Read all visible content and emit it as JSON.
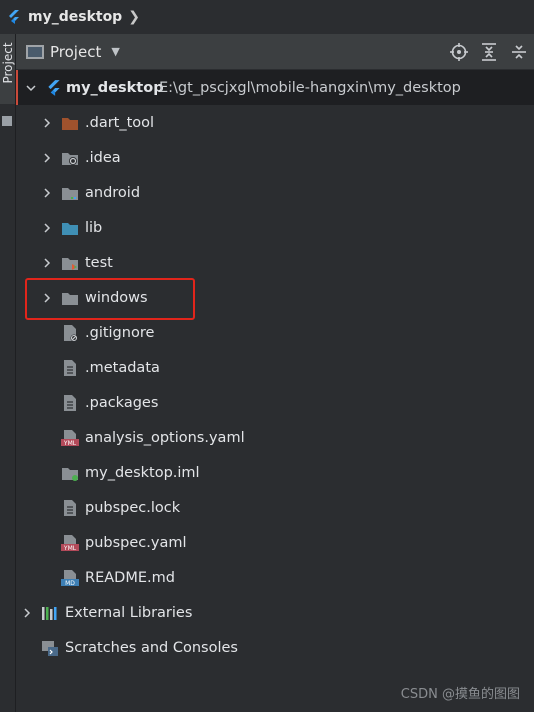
{
  "breadcrumb": {
    "project": "my_desktop"
  },
  "toolwindow": {
    "side_tab_label": "Project",
    "title": "Project",
    "toolbar_icons": [
      "crosshair-icon",
      "collapse-all-icon",
      "expand-icon"
    ]
  },
  "tree": {
    "root": {
      "name": "my_desktop",
      "path": "E:\\gt_pscjxgl\\mobile-hangxin\\my_desktop"
    },
    "folders": [
      {
        "label": ".dart_tool",
        "icon": "folder-excluded-icon",
        "color": "#a0522d"
      },
      {
        "label": ".idea",
        "icon": "folder-idea-icon",
        "color": "#8a8f94"
      },
      {
        "label": "android",
        "icon": "folder-module-icon",
        "color": "#8a8f94"
      },
      {
        "label": "lib",
        "icon": "folder-source-icon",
        "color": "#3f8fb5"
      },
      {
        "label": "test",
        "icon": "folder-test-icon",
        "color": "#8a8f94"
      },
      {
        "label": "windows",
        "icon": "folder-icon",
        "color": "#8a8f94"
      }
    ],
    "files": [
      {
        "label": ".gitignore",
        "icon": "gitignore-file-icon"
      },
      {
        "label": ".metadata",
        "icon": "text-file-icon"
      },
      {
        "label": ".packages",
        "icon": "text-file-icon"
      },
      {
        "label": "analysis_options.yaml",
        "icon": "yaml-file-icon"
      },
      {
        "label": "my_desktop.iml",
        "icon": "iml-file-icon"
      },
      {
        "label": "pubspec.lock",
        "icon": "text-file-icon"
      },
      {
        "label": "pubspec.yaml",
        "icon": "yaml-file-icon"
      },
      {
        "label": "README.md",
        "icon": "markdown-file-icon"
      }
    ],
    "external_libraries": "External Libraries",
    "scratches": "Scratches and Consoles"
  },
  "watermark": "CSDN @摸鱼的图图",
  "colors": {
    "highlight": "#e1251b",
    "flutter": "#42a5f5"
  }
}
